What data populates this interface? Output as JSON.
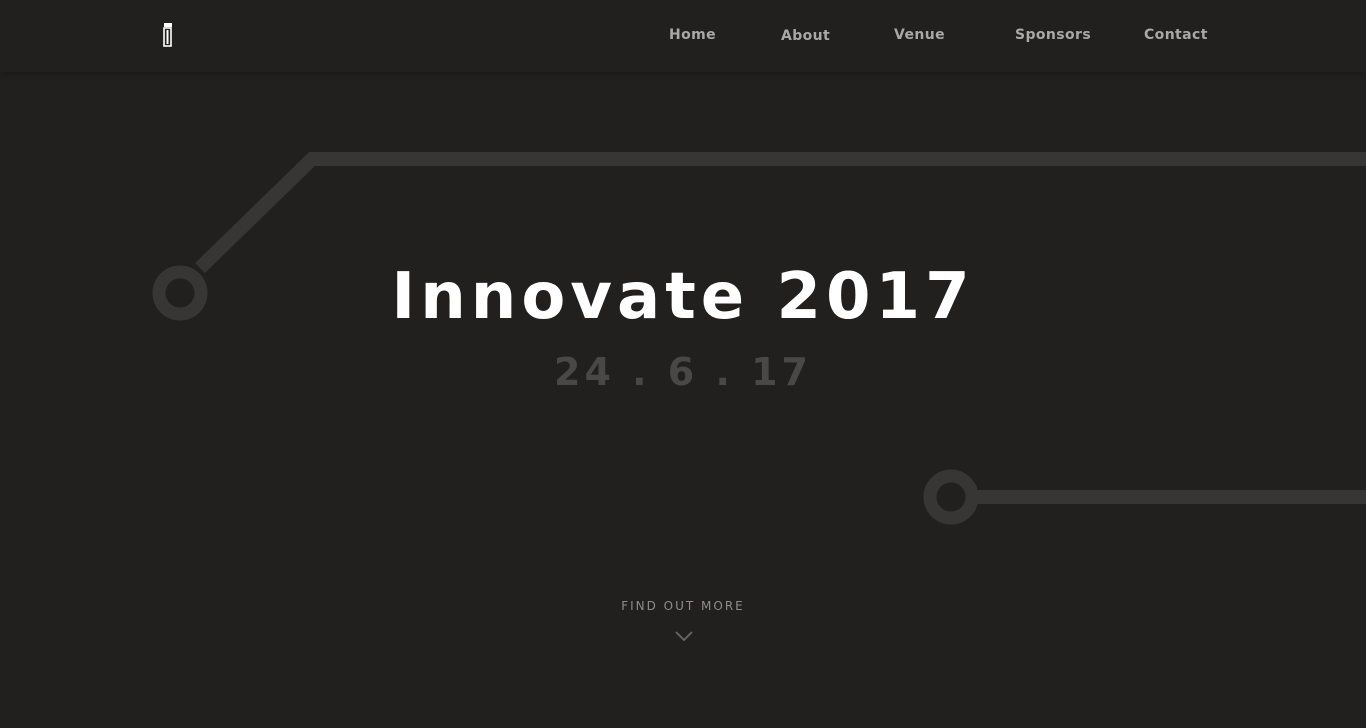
{
  "nav": {
    "logo_icon": "innovate-logo-icon",
    "links": [
      {
        "label": "Home"
      },
      {
        "label": "About"
      },
      {
        "label": "Venue"
      },
      {
        "label": "Sponsors"
      },
      {
        "label": "Contact"
      }
    ]
  },
  "hero": {
    "title": "Innovate 2017",
    "date": "24 . 6 . 17"
  },
  "cta": {
    "label": "FIND OUT MORE",
    "icon": "chevron-down-icon"
  },
  "colors": {
    "background": "#221f1f",
    "circuit": "#3a3737",
    "title": "#ffffff",
    "date": "#4a4747",
    "nav_text": "#a9a7a7"
  }
}
